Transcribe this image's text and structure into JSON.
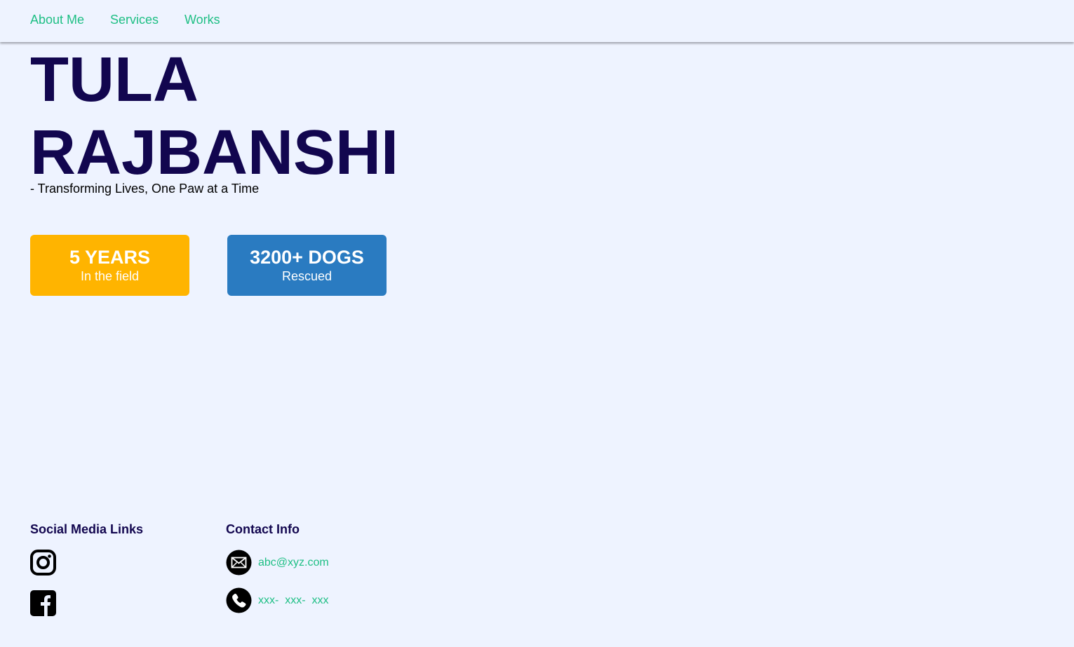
{
  "nav": {
    "links": [
      "About Me",
      "Services",
      "Works"
    ]
  },
  "hero": {
    "name_line1": "TULA",
    "name_line2": "RAJBANSHI",
    "tagline": "- Transforming Lives, One Paw at a Time"
  },
  "stats": [
    {
      "value": "5 YEARS",
      "label": "In the field",
      "color": "#ffb400"
    },
    {
      "value": "3200+ DOGS",
      "label": "Rescued",
      "color": "#2a7bc1"
    }
  ],
  "footer": {
    "social_heading": "Social Media Links",
    "social_icons": [
      "instagram-icon",
      "facebook-icon"
    ],
    "contact_heading": "Contact Info",
    "email": "abc@xyz.com",
    "phone": "xxx-  xxx-  xxx",
    "contact_icons": [
      "mail-icon",
      "phone-icon"
    ]
  },
  "colors": {
    "background": "#eef3ff",
    "accent_green": "#1fbf85",
    "heading_navy": "#12064f"
  }
}
